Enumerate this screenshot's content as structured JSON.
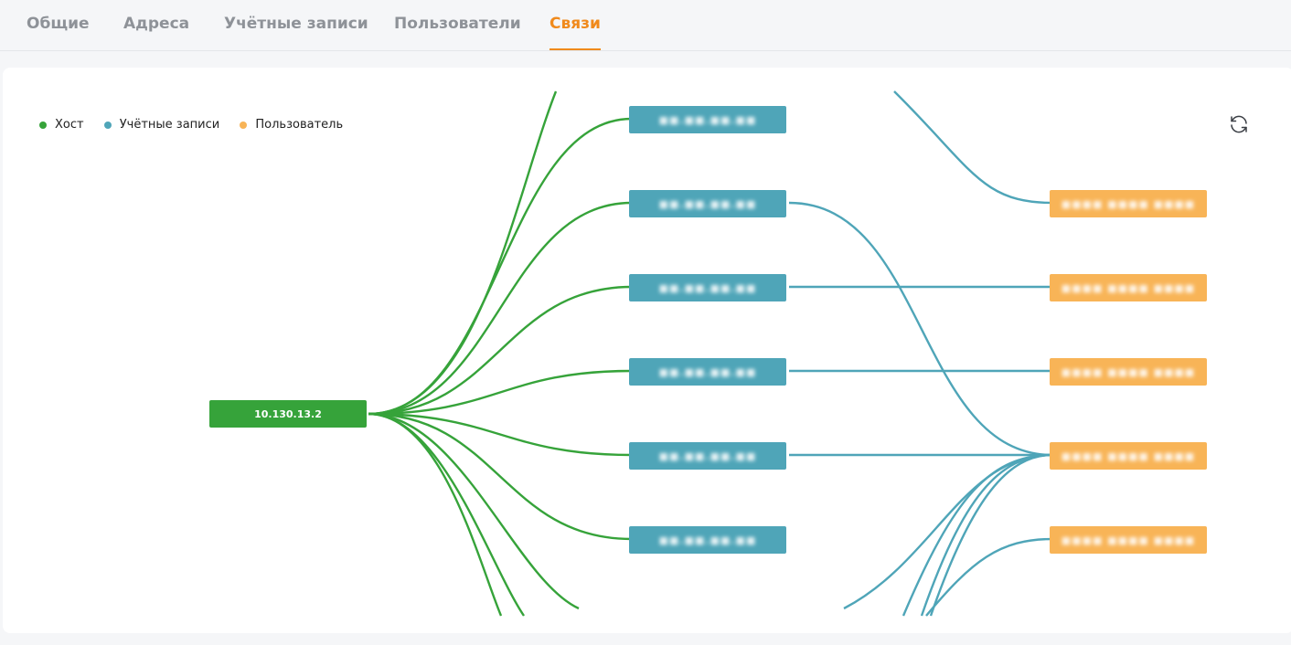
{
  "tabs": [
    {
      "label": "Общие",
      "active": false
    },
    {
      "label": "Адреса",
      "active": false
    },
    {
      "label": "Учётные записи",
      "active": false
    },
    {
      "label": "Пользователи",
      "active": false
    },
    {
      "label": "Связи",
      "active": true
    }
  ],
  "legend": [
    {
      "label": "Хост",
      "color": "#36a33a"
    },
    {
      "label": "Учётные записи",
      "color": "#4fa5b8"
    },
    {
      "label": "Пользователь",
      "color": "#f8b457"
    }
  ],
  "refresh_icon": "refresh-icon",
  "colors": {
    "host": "#36a33a",
    "account": "#4fa5b8",
    "user": "#f8b457",
    "active_tab": "#f08a1c"
  },
  "graph": {
    "host": {
      "label": "10.130.13.2"
    },
    "accounts": [
      {
        "label": "■■.■■.■■.■■"
      },
      {
        "label": "■■.■■.■■.■■"
      },
      {
        "label": "■■.■■.■■.■■"
      },
      {
        "label": "■■.■■.■■.■■"
      },
      {
        "label": "■■.■■.■■.■■"
      },
      {
        "label": "■■.■■.■■.■■"
      }
    ],
    "users": [
      {
        "label": "■■■■ ■■■■ ■■■■"
      },
      {
        "label": "■■■■ ■■■■ ■■■■"
      },
      {
        "label": "■■■■ ■■■■ ■■■■"
      },
      {
        "label": "■■■■ ■■■■ ■■■■"
      },
      {
        "label": "■■■■ ■■■■ ■■■■"
      }
    ]
  }
}
